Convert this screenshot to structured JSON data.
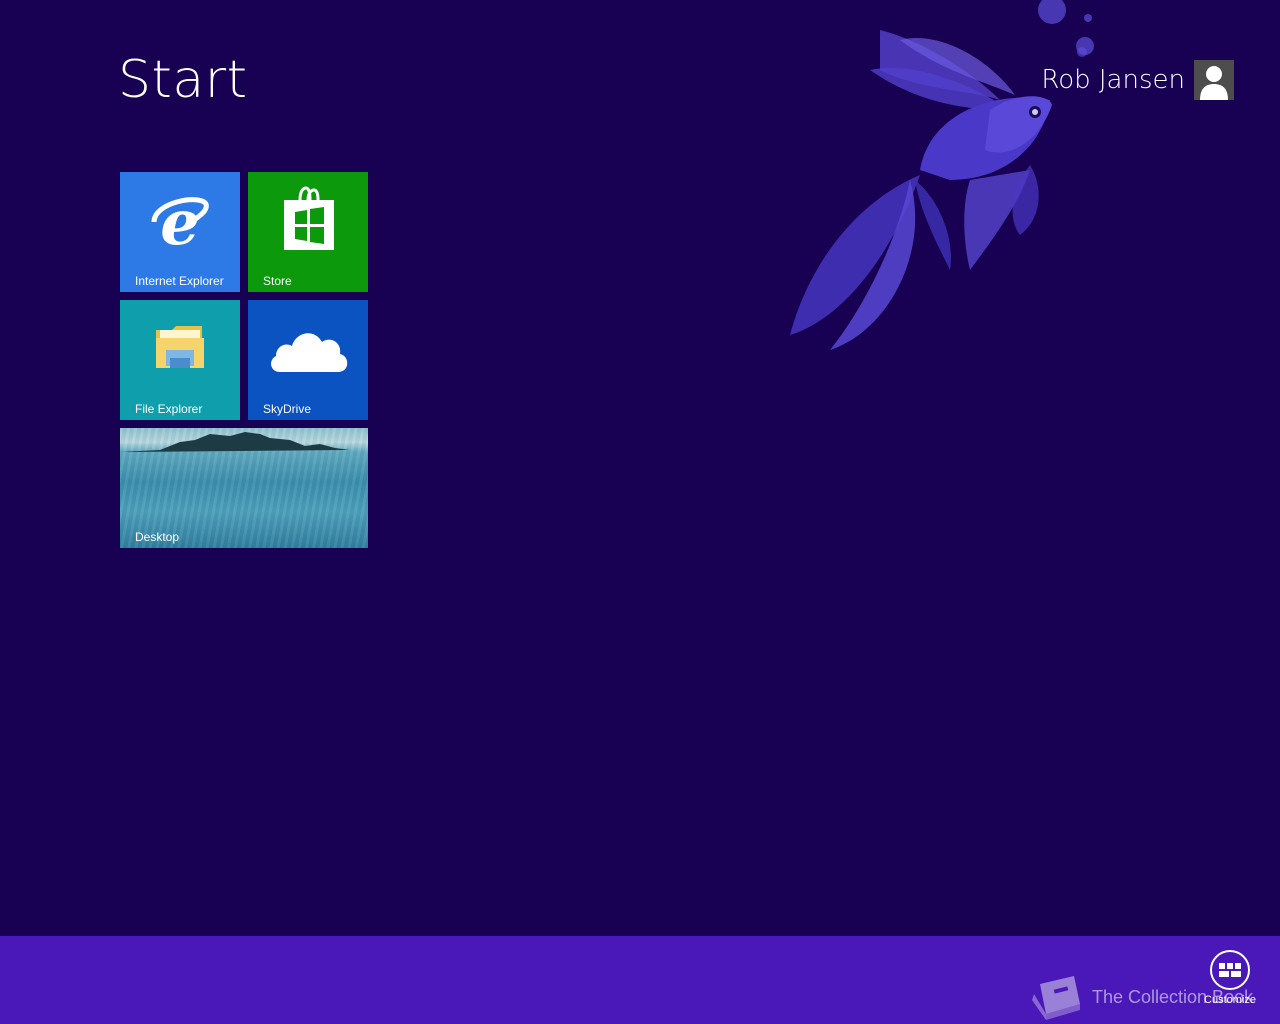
{
  "header": {
    "title": "Start"
  },
  "user": {
    "name": "Rob Jansen",
    "avatar_icon": "user-silhouette-icon"
  },
  "tiles": [
    {
      "id": "internet-explorer",
      "label": "Internet Explorer",
      "icon": "internet-explorer-icon",
      "color": "#2d7ae6"
    },
    {
      "id": "store",
      "label": "Store",
      "icon": "store-bag-icon",
      "color": "#0c9a0c"
    },
    {
      "id": "file-explorer",
      "label": "File Explorer",
      "icon": "folder-icon",
      "color": "#0f9eab"
    },
    {
      "id": "skydrive",
      "label": "SkyDrive",
      "icon": "cloud-icon",
      "color": "#0a53c1"
    },
    {
      "id": "desktop",
      "label": "Desktop",
      "icon": "desktop-wallpaper"
    }
  ],
  "app_bar": {
    "customize_label": "Customize",
    "customize_icon": "customize-grid-icon"
  },
  "watermark": {
    "text": "The Collection Book",
    "icon": "book-icon"
  },
  "colors": {
    "background": "#180052",
    "app_bar": "#4a18b8"
  }
}
